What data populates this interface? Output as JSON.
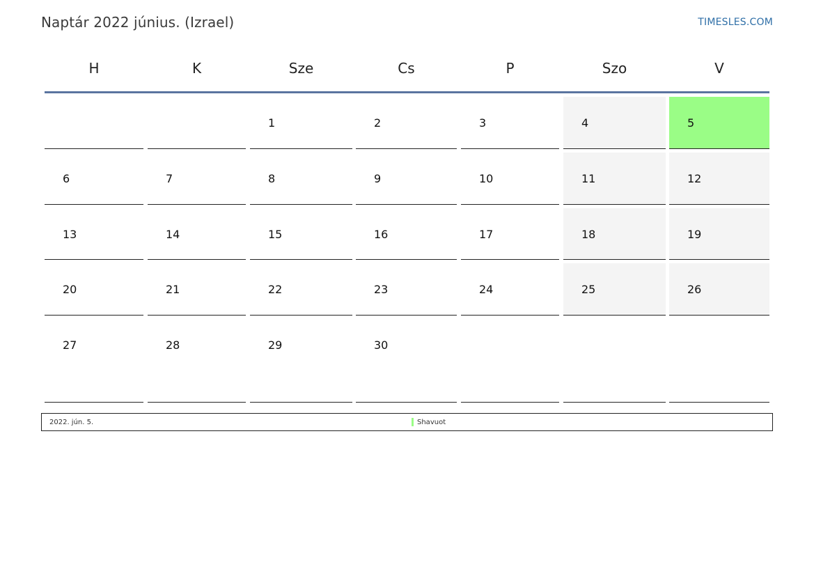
{
  "title": "Naptár 2022 június. (Izrael)",
  "site": "TIMESLES.COM",
  "colors": {
    "weekend": "#f4f4f4",
    "holiday": "#9afd86",
    "header_line": "#5a74a0",
    "link": "#2f6fa7"
  },
  "weekdays": [
    "H",
    "K",
    "Sze",
    "Cs",
    "P",
    "Szo",
    "V"
  ],
  "weeks": [
    [
      "",
      "",
      "1",
      "2",
      "3",
      "4",
      "5"
    ],
    [
      "6",
      "7",
      "8",
      "9",
      "10",
      "11",
      "12"
    ],
    [
      "13",
      "14",
      "15",
      "16",
      "17",
      "18",
      "19"
    ],
    [
      "20",
      "21",
      "22",
      "23",
      "24",
      "25",
      "26"
    ],
    [
      "27",
      "28",
      "29",
      "30",
      "",
      "",
      ""
    ]
  ],
  "holidays": [
    {
      "date_label": "2022. jún. 5.",
      "day": "5",
      "name": "Shavuot"
    }
  ]
}
